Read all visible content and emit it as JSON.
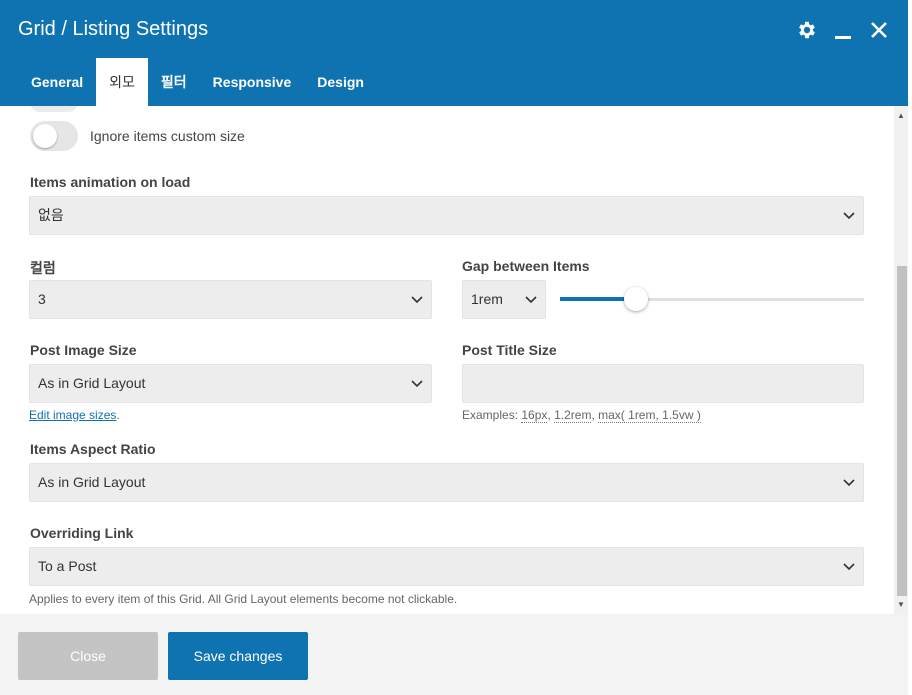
{
  "window": {
    "title": "Grid / Listing Settings",
    "icons": [
      "gear-icon",
      "minimize-icon",
      "close-icon"
    ]
  },
  "tabs": [
    {
      "label": "General",
      "active": false
    },
    {
      "label": "외모",
      "active": true
    },
    {
      "label": "필터",
      "active": false
    },
    {
      "label": "Responsive",
      "active": false
    },
    {
      "label": "Design",
      "active": false
    }
  ],
  "toggle_ignore": {
    "label": "Ignore items custom size",
    "on": false
  },
  "animation": {
    "label": "Items animation on load",
    "value": "없음"
  },
  "columns": {
    "label": "컬럼",
    "value": "3"
  },
  "gap": {
    "label": "Gap between Items",
    "unit": "1rem",
    "slider_fraction": 0.25
  },
  "image_size": {
    "label": "Post Image Size",
    "value": "As in Grid Layout",
    "link": "Edit image sizes",
    "link_suffix": "."
  },
  "title_size": {
    "label": "Post Title Size",
    "value": "",
    "examples_prefix": "Examples:",
    "ex1": "16px",
    "ex2": "1.2rem",
    "ex3": "max( 1rem, 1.5vw )",
    "sep": ","
  },
  "aspect": {
    "label": "Items Aspect Ratio",
    "value": "As in Grid Layout"
  },
  "overriding": {
    "label": "Overriding Link",
    "value": "To a Post",
    "hint": "Applies to every item of this Grid. All Grid Layout elements become not clickable."
  },
  "footer": {
    "close_label": "Close",
    "save_label": "Save changes"
  },
  "colors": {
    "accent": "#0f73b1",
    "field_bg": "#ededed",
    "close_bg": "#c4c4c4"
  }
}
